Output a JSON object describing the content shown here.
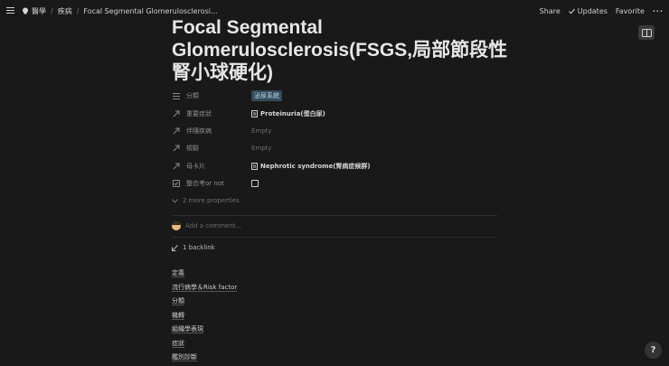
{
  "topbar": {
    "breadcrumbs": [
      "醫學",
      "疾病",
      "Focal Segmental Glomerulosclerosi..."
    ],
    "share_label": "Share",
    "updates_label": "Updates",
    "favorite_label": "Favorite",
    "more_label": "···"
  },
  "page": {
    "title": "Focal Segmental Glomerulosclerosis(FSGS,局部節段性腎小球硬化)"
  },
  "properties": [
    {
      "name": "分類",
      "value": "泌尿系統",
      "kind": "tag"
    },
    {
      "name": "重要症狀",
      "value": "Proteinuria(蛋白尿)",
      "kind": "relation"
    },
    {
      "name": "伴隨疾病",
      "value": "Empty",
      "kind": "empty"
    },
    {
      "name": "檢驗",
      "value": "Empty",
      "kind": "empty"
    },
    {
      "name": "母卡片",
      "value": "Nephrotic syndrome(腎病症候群)",
      "kind": "relation"
    },
    {
      "name": "整合考or not",
      "value": "",
      "kind": "checkbox"
    }
  ],
  "more_properties_label": "2 more properties",
  "comment_placeholder": "Add a comment...",
  "backlink_label": "1 backlink",
  "toc": [
    "定義",
    "流行病學＆Risk factor",
    "分類",
    "機轉",
    "組織學表現",
    "症狀",
    "鑑別診斷"
  ],
  "help_label": "?"
}
